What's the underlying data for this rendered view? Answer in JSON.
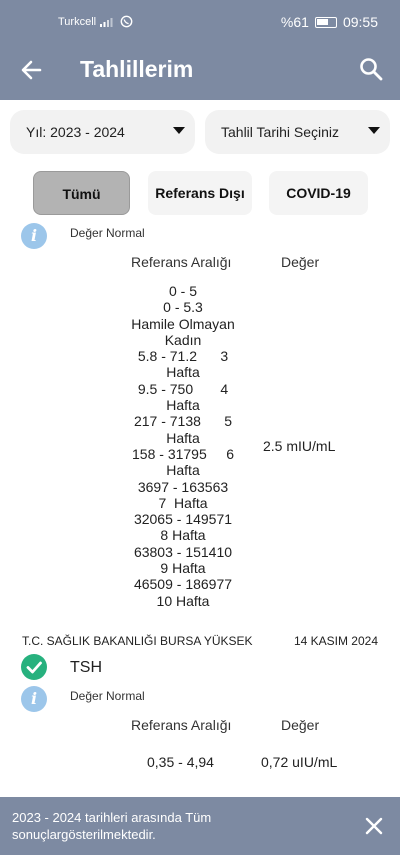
{
  "status_bar": {
    "carrier": "Turkcell",
    "battery": "%61",
    "time": "09:55"
  },
  "app_bar": {
    "title": "Tahlillerim"
  },
  "filters": {
    "year_dropdown": "Yıl: 2023 - 2024",
    "date_dropdown": "Tahlil Tarihi Seçiniz",
    "chips": [
      "Tümü",
      "Referans Dışı",
      "COVID-19"
    ]
  },
  "result_1": {
    "status": "Değer Normal",
    "range_header": "Referans Aralığı",
    "value_header": "Değer",
    "range_lines": [
      "0 - 5",
      "0 - 5.3",
      "Hamile Olmayan",
      "Kadın",
      "5.8 - 71.2      3",
      "Hafta",
      "9.5 - 750       4",
      "Hafta",
      "217 - 7138      5",
      "Hafta",
      "158 - 31795     6",
      "Hafta",
      "3697 - 163563",
      "7  Hafta",
      "32065 - 149571",
      "8 Hafta",
      "63803 - 151410",
      "9 Hafta",
      "46509 - 186977",
      "10 Hafta"
    ],
    "value": "2.5 mIU/mL"
  },
  "result_2": {
    "institution": "T.C. SAĞLIK BAKANLIĞI BURSA YÜKSEK",
    "date": "14 KASIM 2024",
    "test_name": "TSH",
    "status": "Değer Normal",
    "range_header": "Referans Aralığı",
    "value_header": "Değer",
    "range": "0,35 - 4,94",
    "value": "0,72 uIU/mL"
  },
  "snackbar": {
    "message": "2023 - 2024 tarihleri arasında Tüm sonuçlargösterilmektedir."
  },
  "colors": {
    "header": "#7d8aa2",
    "info": "#9cc6ea",
    "check": "#27b17e"
  }
}
